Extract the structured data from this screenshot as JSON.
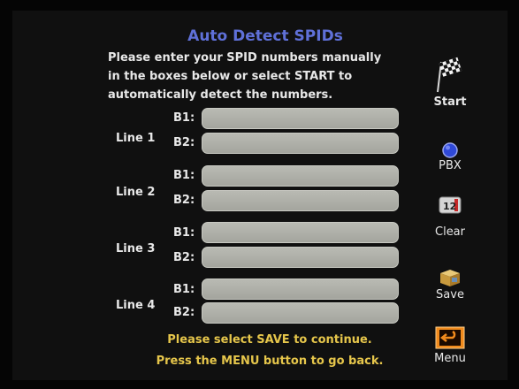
{
  "screen": {
    "title": "Auto Detect SPIDs",
    "instructions": [
      "Please enter your SPID numbers manually",
      "in the boxes below or select START to",
      "automatically detect the numbers."
    ]
  },
  "lines": [
    {
      "label": "Line 1",
      "b1_label": "B1:",
      "b2_label": "B2:",
      "b1_value": "",
      "b2_value": ""
    },
    {
      "label": "Line 2",
      "b1_label": "B1:",
      "b2_label": "B2:",
      "b1_value": "",
      "b2_value": ""
    },
    {
      "label": "Line 3",
      "b1_label": "B1:",
      "b2_label": "B2:",
      "b1_value": "",
      "b2_value": ""
    },
    {
      "label": "Line 4",
      "b1_label": "B1:",
      "b2_label": "B2:",
      "b1_value": "",
      "b2_value": ""
    }
  ],
  "footer": {
    "line1": "Please select SAVE to continue.",
    "line2": "Press the MENU button to go back."
  },
  "side_menu": {
    "start": {
      "label": "Start",
      "icon": "checkered-flag-icon"
    },
    "pbx": {
      "label": "PBX",
      "icon": "blue-dot-icon"
    },
    "clear": {
      "label": "Clear",
      "icon": "calendar-icon",
      "icon_text": "12"
    },
    "save": {
      "label": "Save",
      "icon": "box-icon"
    },
    "menu": {
      "label": "Menu",
      "icon": "back-arrow-icon"
    }
  },
  "colors": {
    "background": "#050505",
    "title": "#5f70d8",
    "text": "#e8e8e8",
    "footer": "#e6c64b",
    "field": "#b0b1aa",
    "accent_orange": "#f08a1c",
    "pbx_blue": "#2f49d8"
  }
}
